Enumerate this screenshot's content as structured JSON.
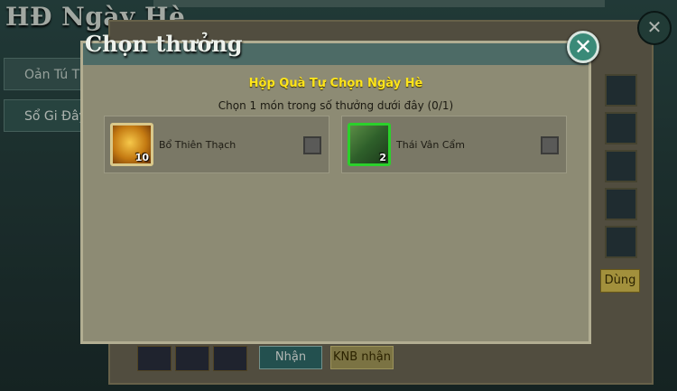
{
  "background": {
    "title": "HĐ Ngày Hè",
    "sidebar_items": [
      {
        "label": "Oản Tú T"
      },
      {
        "label": "Sổ Gi Đây"
      }
    ],
    "buttons": {
      "receive": "Nhận",
      "knb_receive": "KNB nhận",
      "use": "Dùng"
    },
    "close_glyph": "✕"
  },
  "modal": {
    "title": "Chọn thưởng",
    "close_glyph": "✕",
    "box_title": "Hộp Quà Tự Chọn Ngày Hè",
    "instruction": "Chọn 1 món trong số thưởng dưới đây (0/1)",
    "items": [
      {
        "name": "Bổ Thiên Thạch",
        "quantity": "10",
        "icon": "gold-stone-icon",
        "checked": false
      },
      {
        "name": "Thái Vân Cẩm",
        "quantity": "2",
        "icon": "green-brocade-icon",
        "checked": false
      }
    ]
  },
  "colors": {
    "accent_yellow": "#ffe51a",
    "close_button": "#3a8a78",
    "modal_bg": "#8d8b74"
  }
}
